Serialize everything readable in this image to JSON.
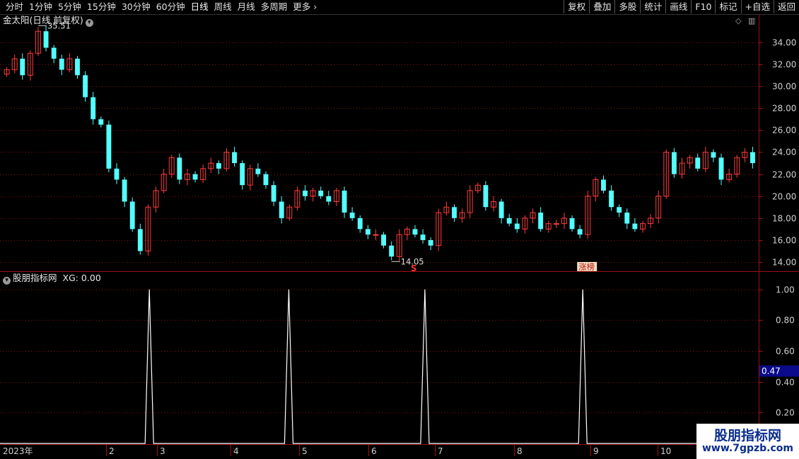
{
  "toolbar": {
    "periods": [
      "分时",
      "1分钟",
      "5分钟",
      "15分钟",
      "30分钟",
      "60分钟",
      "日线",
      "周线",
      "月线",
      "多周期",
      "更多"
    ],
    "active_period": "日线",
    "more_icon": "chevron-right-icon",
    "buttons": [
      "复权",
      "叠加",
      "多股",
      "统计",
      "画线",
      "F10",
      "标记",
      "+自选",
      "返回"
    ]
  },
  "price_panel": {
    "title": "金太阳(日线 前复权)",
    "dropdown_icon": "chevron-down-icon",
    "high_label": "35.51",
    "low_label": "14.05",
    "y_ticks": [
      "34.00",
      "32.00",
      "30.00",
      "28.00",
      "26.00",
      "24.00",
      "22.00",
      "20.00",
      "18.00",
      "16.00",
      "14.00"
    ],
    "markers": {
      "s_label": "S",
      "zhangbang_label": "涨榜"
    }
  },
  "indicator_panel": {
    "title": "股朋指标网",
    "xg_label": "XG: 0.00",
    "dropdown_icon": "chevron-down-icon",
    "y_ticks": [
      "1.00",
      "0.80",
      "0.60",
      "0.40",
      "0.20"
    ],
    "current_value": "0.47"
  },
  "x_axis": {
    "labels": [
      "2023年",
      "2",
      "3",
      "4",
      "5",
      "6",
      "7",
      "8",
      "9",
      "10"
    ]
  },
  "watermark": {
    "line1": "股朋指标网",
    "line2": "www.7gpzb.com"
  },
  "chart_data": {
    "type": "candlestick",
    "title": "金太阳(日线 前复权)",
    "ylim": [
      13.3,
      36.3
    ],
    "price_ticks": [
      34,
      32,
      30,
      28,
      26,
      24,
      22,
      20,
      18,
      16,
      14
    ],
    "high": 35.51,
    "low": 14.05,
    "months": [
      "2023年",
      "2",
      "3",
      "4",
      "5",
      "6",
      "7",
      "8",
      "9",
      "10"
    ],
    "close_path": [
      31.5,
      32.5,
      31.0,
      33.0,
      35.0,
      33.5,
      32.5,
      31.5,
      32.5,
      31.0,
      29.0,
      27.0,
      26.5,
      22.5,
      21.5,
      19.5,
      17.0,
      15.0,
      19.0,
      20.5,
      22.0,
      23.5,
      21.5,
      22.0,
      21.5,
      22.5,
      23.0,
      22.5,
      24.0,
      23.0,
      21.0,
      22.5,
      22.0,
      21.0,
      19.5,
      18.0,
      19.0,
      20.5,
      20.0,
      20.5,
      20.0,
      19.5,
      20.5,
      18.5,
      18.0,
      17.0,
      16.5,
      16.5,
      15.5,
      14.5,
      16.5,
      17.0,
      16.5,
      16.0,
      15.5,
      18.5,
      19.0,
      18.0,
      18.5,
      20.5,
      21.0,
      19.0,
      19.5,
      18.0,
      17.5,
      17.0,
      18.0,
      18.5,
      17.0,
      17.5,
      17.5,
      18.0,
      17.0,
      16.5,
      20.0,
      21.5,
      20.5,
      19.0,
      18.5,
      17.5,
      17.0,
      17.5,
      18.0,
      20.0,
      24.0,
      22.0,
      23.0,
      23.5,
      22.5,
      24.0,
      23.5,
      21.5,
      22.0,
      23.5,
      24.0,
      23.0
    ],
    "indicator": {
      "name": "XG",
      "ylim": [
        0,
        1.1
      ],
      "ticks": [
        1.0,
        0.8,
        0.6,
        0.4,
        0.2
      ],
      "current": 0.47,
      "spike_months": [
        1.85,
        3.85,
        5.85,
        7.9
      ]
    }
  }
}
